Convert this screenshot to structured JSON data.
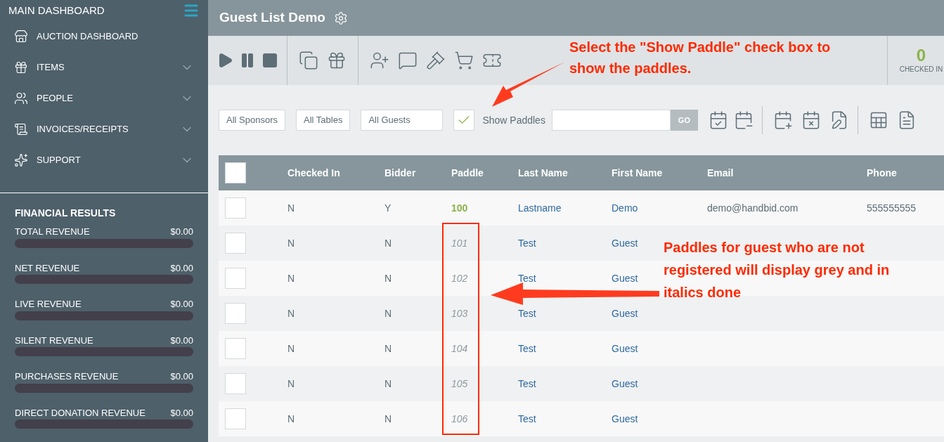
{
  "sidebar": {
    "title": "MAIN DASHBOARD",
    "items": [
      {
        "label": "AUCTION DASHBOARD",
        "expandable": false
      },
      {
        "label": "ITEMS",
        "expandable": true
      },
      {
        "label": "PEOPLE",
        "expandable": true
      },
      {
        "label": "INVOICES/RECEIPTS",
        "expandable": true
      },
      {
        "label": "SUPPORT",
        "expandable": true
      }
    ],
    "financial": {
      "title": "FINANCIAL RESULTS",
      "rows": [
        {
          "label": "TOTAL REVENUE",
          "amount": "$0.00",
          "level": 0
        },
        {
          "label": "NET REVENUE",
          "amount": "$0.00",
          "level": 0
        },
        {
          "label": "LIVE REVENUE",
          "amount": "$0.00",
          "level": 0
        },
        {
          "label": "SILENT REVENUE",
          "amount": "$0.00",
          "level": 0
        },
        {
          "label": "PURCHASES REVENUE",
          "amount": "$0.00",
          "level": 0
        },
        {
          "label": "DIRECT DONATION REVENUE",
          "amount": "$0.00",
          "level": 0
        }
      ]
    }
  },
  "header": {
    "title": "Guest List Demo"
  },
  "checked_in": {
    "count": "0",
    "label": "CHECKED IN"
  },
  "filters": {
    "sponsors": "All Sponsors",
    "tables": "All Tables",
    "guests": "All Guests",
    "show_paddles": {
      "label": "Show Paddles",
      "checked": true
    },
    "go": "GO"
  },
  "table": {
    "select_all_checked": false,
    "columns": [
      "Checked In",
      "Bidder",
      "Paddle",
      "Last Name",
      "First Name",
      "Email",
      "Phone"
    ],
    "rows": [
      {
        "checked": false,
        "checked_in": "N",
        "bidder": "Y",
        "paddle": "100",
        "registered": true,
        "last_name": "Lastname",
        "first_name": "Demo",
        "email": "demo@handbid.com",
        "phone": "555555555"
      },
      {
        "checked": false,
        "checked_in": "N",
        "bidder": "N",
        "paddle": "101",
        "registered": false,
        "last_name": "Test",
        "first_name": "Guest"
      },
      {
        "checked": false,
        "checked_in": "N",
        "bidder": "N",
        "paddle": "102",
        "registered": false,
        "last_name": "Test",
        "first_name": "Guest"
      },
      {
        "checked": false,
        "checked_in": "N",
        "bidder": "N",
        "paddle": "103",
        "registered": false,
        "last_name": "Test",
        "first_name": "Guest"
      },
      {
        "checked": false,
        "checked_in": "N",
        "bidder": "N",
        "paddle": "104",
        "registered": false,
        "last_name": "Test",
        "first_name": "Guest"
      },
      {
        "checked": false,
        "checked_in": "N",
        "bidder": "N",
        "paddle": "105",
        "registered": false,
        "last_name": "Test",
        "first_name": "Guest"
      },
      {
        "checked": false,
        "checked_in": "N",
        "bidder": "N",
        "paddle": "106",
        "registered": false,
        "last_name": "Test",
        "first_name": "Guest"
      }
    ]
  },
  "annotations": [
    {
      "text": "Select the \"Show Paddle\" check box to show the paddles."
    },
    {
      "text": "Paddles for guest who are not registered will display grey and in italics done"
    }
  ]
}
